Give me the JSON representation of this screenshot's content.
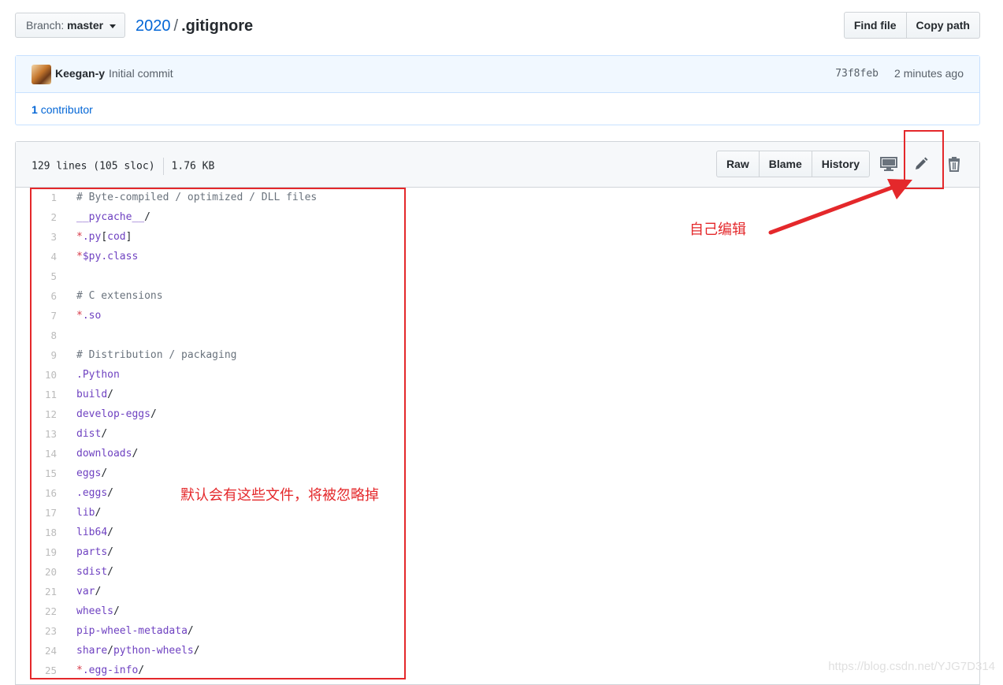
{
  "header": {
    "branch_prefix": "Branch:",
    "branch_name": "master",
    "repo": "2020",
    "separator": "/",
    "file_name": ".gitignore",
    "find_file": "Find file",
    "copy_path": "Copy path"
  },
  "commit": {
    "author": "Keegan-y",
    "message": "Initial commit",
    "sha": "73f8feb",
    "time": "2 minutes ago",
    "contributors_count": "1",
    "contributors_label": "contributor"
  },
  "file": {
    "lines_info": "129 lines (105 sloc)",
    "size": "1.76 KB",
    "raw": "Raw",
    "blame": "Blame",
    "history": "History",
    "icons": [
      "desktop-icon",
      "pencil-icon",
      "trash-icon"
    ]
  },
  "code_lines": [
    {
      "n": "1",
      "text": "# Byte-compiled / optimized / DLL files"
    },
    {
      "n": "2",
      "text": "__pycache__/"
    },
    {
      "n": "3",
      "text": "*.py[cod]"
    },
    {
      "n": "4",
      "text": "*$py.class"
    },
    {
      "n": "5",
      "text": ""
    },
    {
      "n": "6",
      "text": "# C extensions"
    },
    {
      "n": "7",
      "text": "*.so"
    },
    {
      "n": "8",
      "text": ""
    },
    {
      "n": "9",
      "text": "# Distribution / packaging"
    },
    {
      "n": "10",
      "text": ".Python"
    },
    {
      "n": "11",
      "text": "build/"
    },
    {
      "n": "12",
      "text": "develop-eggs/"
    },
    {
      "n": "13",
      "text": "dist/"
    },
    {
      "n": "14",
      "text": "downloads/"
    },
    {
      "n": "15",
      "text": "eggs/"
    },
    {
      "n": "16",
      "text": ".eggs/"
    },
    {
      "n": "17",
      "text": "lib/"
    },
    {
      "n": "18",
      "text": "lib64/"
    },
    {
      "n": "19",
      "text": "parts/"
    },
    {
      "n": "20",
      "text": "sdist/"
    },
    {
      "n": "21",
      "text": "var/"
    },
    {
      "n": "22",
      "text": "wheels/"
    },
    {
      "n": "23",
      "text": "pip-wheel-metadata/"
    },
    {
      "n": "24",
      "text": "share/python-wheels/"
    },
    {
      "n": "25",
      "text": "*.egg-info/"
    }
  ],
  "annotations": {
    "edit_note": "自己编辑",
    "ignore_note": "默认会有这些文件，将被忽略掉",
    "color": "#e4282b"
  },
  "watermark": "https://blog.csdn.net/YJG7D314"
}
